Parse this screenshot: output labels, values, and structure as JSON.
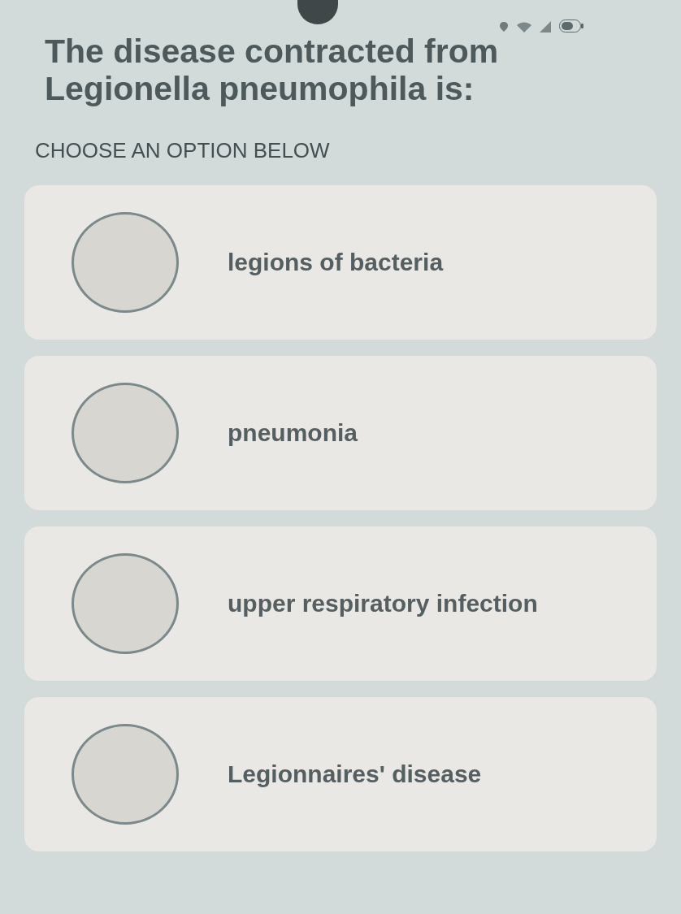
{
  "question": {
    "title": "The disease contracted from Legionella pneumophila is:",
    "instruction": "CHOOSE AN OPTION BELOW"
  },
  "options": [
    {
      "label": "legions of bacteria",
      "selected": false
    },
    {
      "label": "pneumonia",
      "selected": false
    },
    {
      "label": "upper respiratory infection",
      "selected": false
    },
    {
      "label": "Legionnaires' disease",
      "selected": false
    }
  ]
}
